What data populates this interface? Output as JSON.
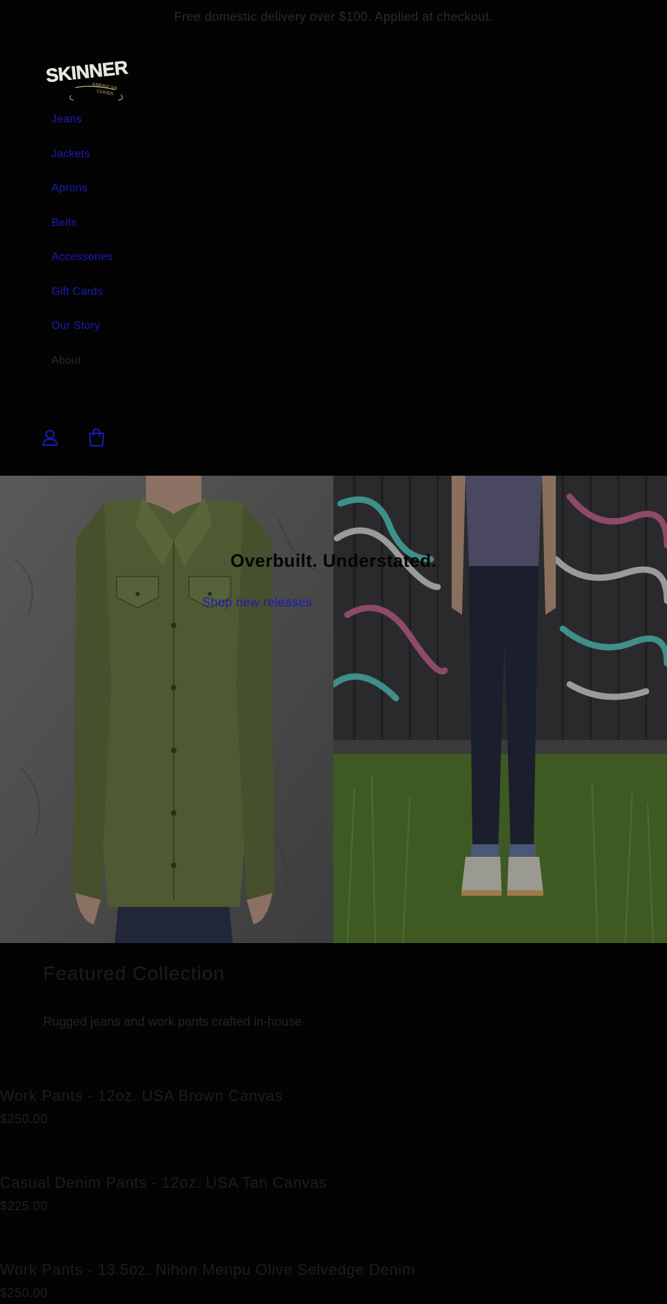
{
  "announcement": "Free domestic delivery over $100. Applied at checkout.",
  "brand": {
    "name": "SKINNER",
    "tagline_line1": "AMERICAN",
    "tagline_line2": "GOODS"
  },
  "nav": {
    "items": [
      {
        "label": "Jeans"
      },
      {
        "label": "Jackets"
      },
      {
        "label": "Aprons"
      },
      {
        "label": "Belts"
      },
      {
        "label": "Accessories"
      },
      {
        "label": "Gift Cards"
      },
      {
        "label": "Our Story"
      },
      {
        "label": "About"
      }
    ]
  },
  "header_icons": {
    "account": "account-icon",
    "cart": "cart-icon",
    "link_color": "#1c1ab8"
  },
  "hero": {
    "title": "Overbuilt. Understated.",
    "cta": "Shop new releases"
  },
  "featured": {
    "title": "Featured Collection",
    "description": "Rugged jeans and work pants crafted in-house",
    "products": [
      {
        "title": "Work Pants - 12oz. USA Brown Canvas",
        "price": "$250.00"
      },
      {
        "title": "Casual Denim Pants - 12oz. USA Tan Canvas",
        "price": "$225.00"
      },
      {
        "title": "Work Pants - 13.5oz. Nihon Menpu Olive Selvedge Denim",
        "price": "$250.00"
      }
    ]
  }
}
